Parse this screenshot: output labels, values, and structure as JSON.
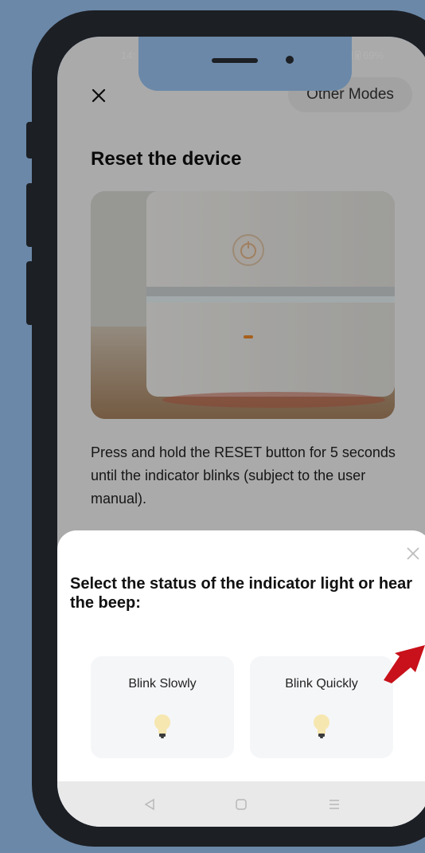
{
  "status_bar": {
    "time": "14:",
    "battery": "69%"
  },
  "header": {
    "close_icon": "close-icon",
    "other_modes_label": "Other Modes"
  },
  "page": {
    "title": "Reset the device",
    "instructions": "Press and hold the RESET button for 5 seconds until the indicator blinks (subject to the user manual)."
  },
  "sheet": {
    "title": "Select the status of the indicator light or hear the beep:",
    "options": [
      {
        "label": "Blink Slowly",
        "icon": "bulb-icon"
      },
      {
        "label": "Blink Quickly",
        "icon": "bulb-icon"
      }
    ]
  },
  "nav": {
    "back_icon": "back-triangle-icon",
    "home_icon": "home-square-icon",
    "menu_icon": "menu-lines-icon"
  },
  "colors": {
    "background": "#6b88a8",
    "bezel": "#1c1f24",
    "sheet": "#ffffff",
    "option_card": "#f5f6f8",
    "arrow": "#c8111a",
    "bulb": "#f6e7b0"
  }
}
